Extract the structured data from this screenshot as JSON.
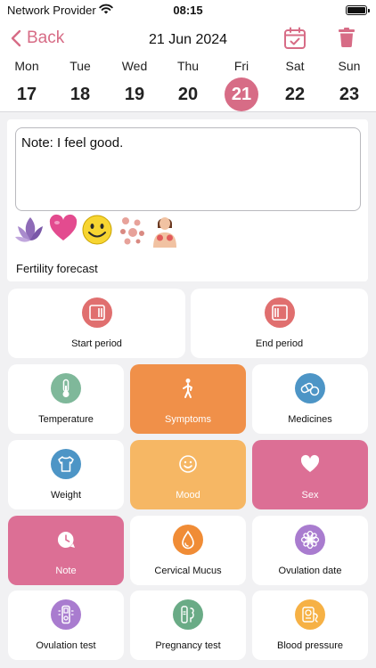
{
  "status_bar": {
    "carrier": "Network Provider",
    "time": "08:15"
  },
  "header": {
    "back_label": "Back",
    "date": "21 Jun 2024"
  },
  "week": [
    {
      "name": "Mon",
      "num": "17"
    },
    {
      "name": "Tue",
      "num": "18"
    },
    {
      "name": "Wed",
      "num": "19"
    },
    {
      "name": "Thu",
      "num": "20"
    },
    {
      "name": "Fri",
      "num": "21",
      "selected": true
    },
    {
      "name": "Sat",
      "num": "22"
    },
    {
      "name": "Sun",
      "num": "23"
    }
  ],
  "note": {
    "text": "Note: I feel good."
  },
  "forecast_label": "Fertility forecast",
  "tiles": {
    "start_period": "Start period",
    "end_period": "End period",
    "temperature": "Temperature",
    "symptoms": "Symptoms",
    "medicines": "Medicines",
    "weight": "Weight",
    "mood": "Mood",
    "sex": "Sex",
    "note": "Note",
    "cervical_mucus": "Cervical Mucus",
    "ovulation_date": "Ovulation date",
    "ovulation_test": "Ovulation test",
    "pregnancy_test": "Pregnancy test",
    "blood_pressure": "Blood pressure"
  },
  "colors": {
    "accent": "#d76c86",
    "period": "#e06f6f",
    "temperature": "#7fb89a",
    "symptoms": "#f09049",
    "medicines": "#4d95c6",
    "mood": "#f6b764",
    "sex": "#dc6f95",
    "cervical_mucus": "#f08c36",
    "ovulation_date": "#a97ccf",
    "pregnancy_test": "#6aab86",
    "blood_pressure": "#f6b145"
  }
}
